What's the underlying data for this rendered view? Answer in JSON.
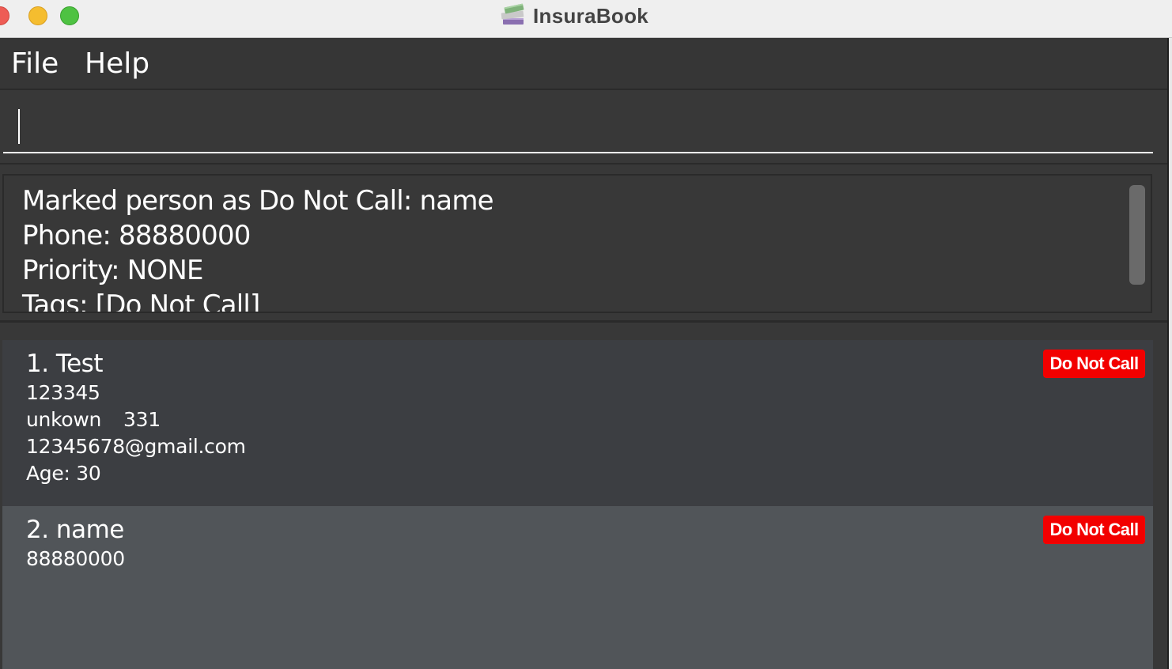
{
  "window": {
    "title": "InsuraBook"
  },
  "menu": {
    "file_label": "File",
    "help_label": "Help"
  },
  "command": {
    "value": "",
    "placeholder": ""
  },
  "result": {
    "lines": [
      "Marked person as Do Not Call: name",
      "Phone: 88880000",
      "Priority: NONE",
      "Tags: [Do Not Call]"
    ]
  },
  "persons": [
    {
      "name": "1. Test",
      "phone": "123345",
      "address": "unkown",
      "address_extra": "331",
      "email": "12345678@gmail.com",
      "age": "Age: 30",
      "tag": "Do Not Call"
    },
    {
      "name": "2. name",
      "phone": "88880000",
      "tag": "Do Not Call"
    }
  ],
  "colors": {
    "tag_do_not_call": "#f20000",
    "background": "#383838",
    "selected_card": "#515559"
  }
}
